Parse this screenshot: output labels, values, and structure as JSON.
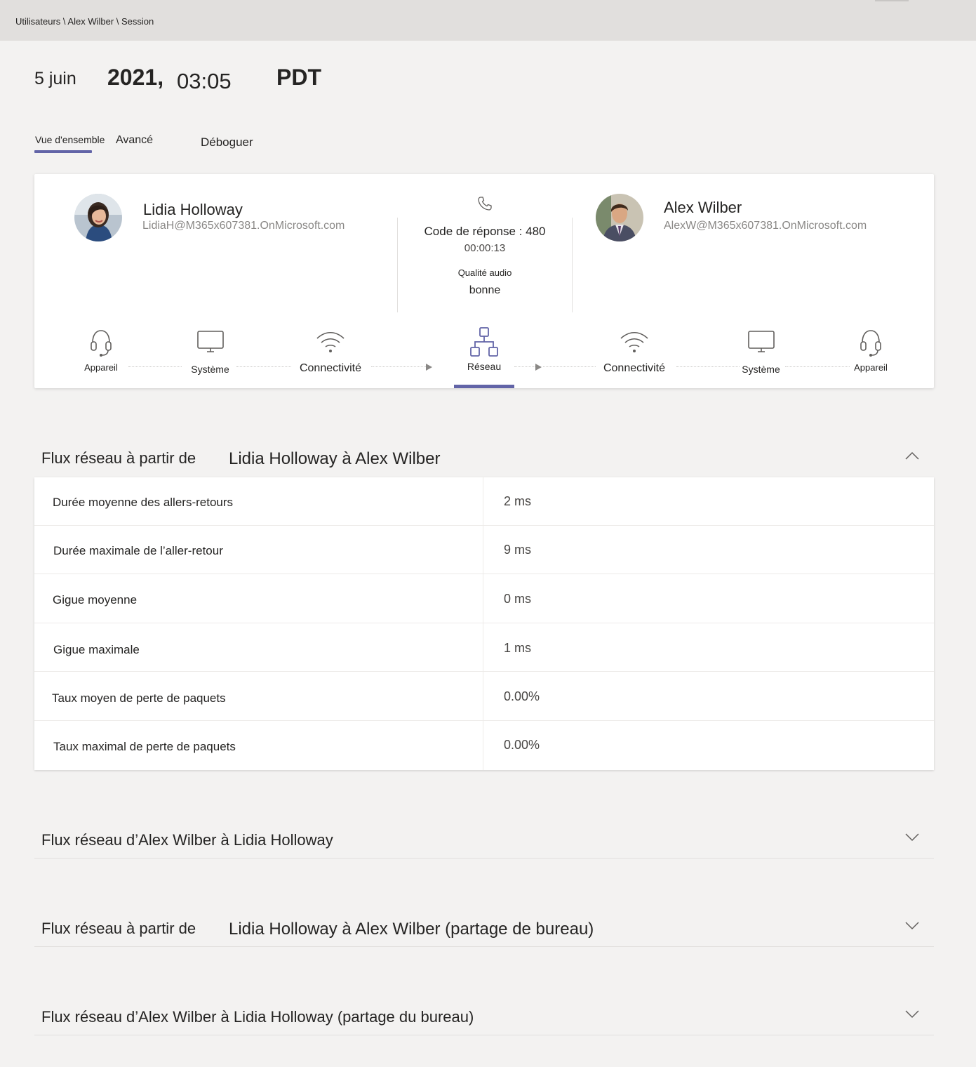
{
  "breadcrumb": "Utilisateurs \\ Alex Wilber \\ Session",
  "datetime": {
    "day": "5 juin",
    "year": "2021,",
    "time": "03:05",
    "tz": "PDT"
  },
  "tabs": {
    "overview": "Vue d'ensemble",
    "advanced": "Avancé",
    "debug": "Déboguer"
  },
  "caller": {
    "name": "Lidia Holloway",
    "email": "LidiaH@M365x607381.OnMicrosoft.com"
  },
  "callee": {
    "name": "Alex Wilber",
    "email": "AlexW@M365x607381.OnMicrosoft.com"
  },
  "call": {
    "response": "Code de réponse : 480",
    "duration": "00:00:13",
    "quality_label": "Qualité audio",
    "quality": "bonne"
  },
  "path": {
    "left_device": "Appareil",
    "left_system": "Système",
    "left_conn": "Connectivité",
    "network": "Réseau",
    "right_conn": "Connectivité",
    "right_system": "Système",
    "right_device": "Appareil"
  },
  "sections": [
    {
      "prefix": "Flux réseau à partir de",
      "title": "Lidia Holloway à Alex Wilber"
    },
    {
      "prefix": "Flux réseau d’Alex Wilber à Lidia Holloway",
      "title": ""
    },
    {
      "prefix": "Flux réseau à partir de",
      "title": "Lidia Holloway à Alex Wilber (partage de bureau)"
    },
    {
      "prefix": "Flux réseau d’Alex Wilber à Lidia Holloway (partage du bureau)",
      "title": ""
    }
  ],
  "metrics": [
    {
      "label": "Durée moyenne des allers-retours",
      "value": "2 ms"
    },
    {
      "label": "Durée maximale de l’aller-retour",
      "value": "9 ms"
    },
    {
      "label": "Gigue moyenne",
      "value": "0 ms"
    },
    {
      "label": "Gigue maximale",
      "value": "1 ms"
    },
    {
      "label": "Taux moyen de perte de paquets",
      "value": "0.00%"
    },
    {
      "label": "Taux maximal de perte de paquets",
      "value": "0.00%"
    }
  ],
  "colors": {
    "accent": "#6264a7",
    "icon": "#605e5c",
    "background": "#f3f2f1"
  }
}
